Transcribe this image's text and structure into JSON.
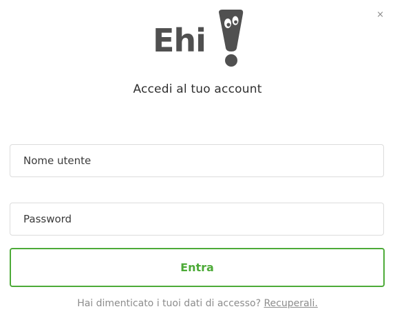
{
  "dialog": {
    "close_label": "×"
  },
  "logo": {
    "text": "Ehi",
    "mark_icon": "exclamation-mascot-icon"
  },
  "subtitle": "Accedi al tuo account",
  "form": {
    "username_placeholder": "Nome utente",
    "username_value": "",
    "password_placeholder": "Password",
    "password_value": "",
    "submit_label": "Entra"
  },
  "footer": {
    "text": "Hai dimenticato i tuoi dati di accesso?",
    "link_label": "Recuperali."
  },
  "colors": {
    "accent": "#4caa37",
    "logo_text": "#505050",
    "muted_text": "#8c8c8c",
    "field_border": "#dcdcdc"
  }
}
